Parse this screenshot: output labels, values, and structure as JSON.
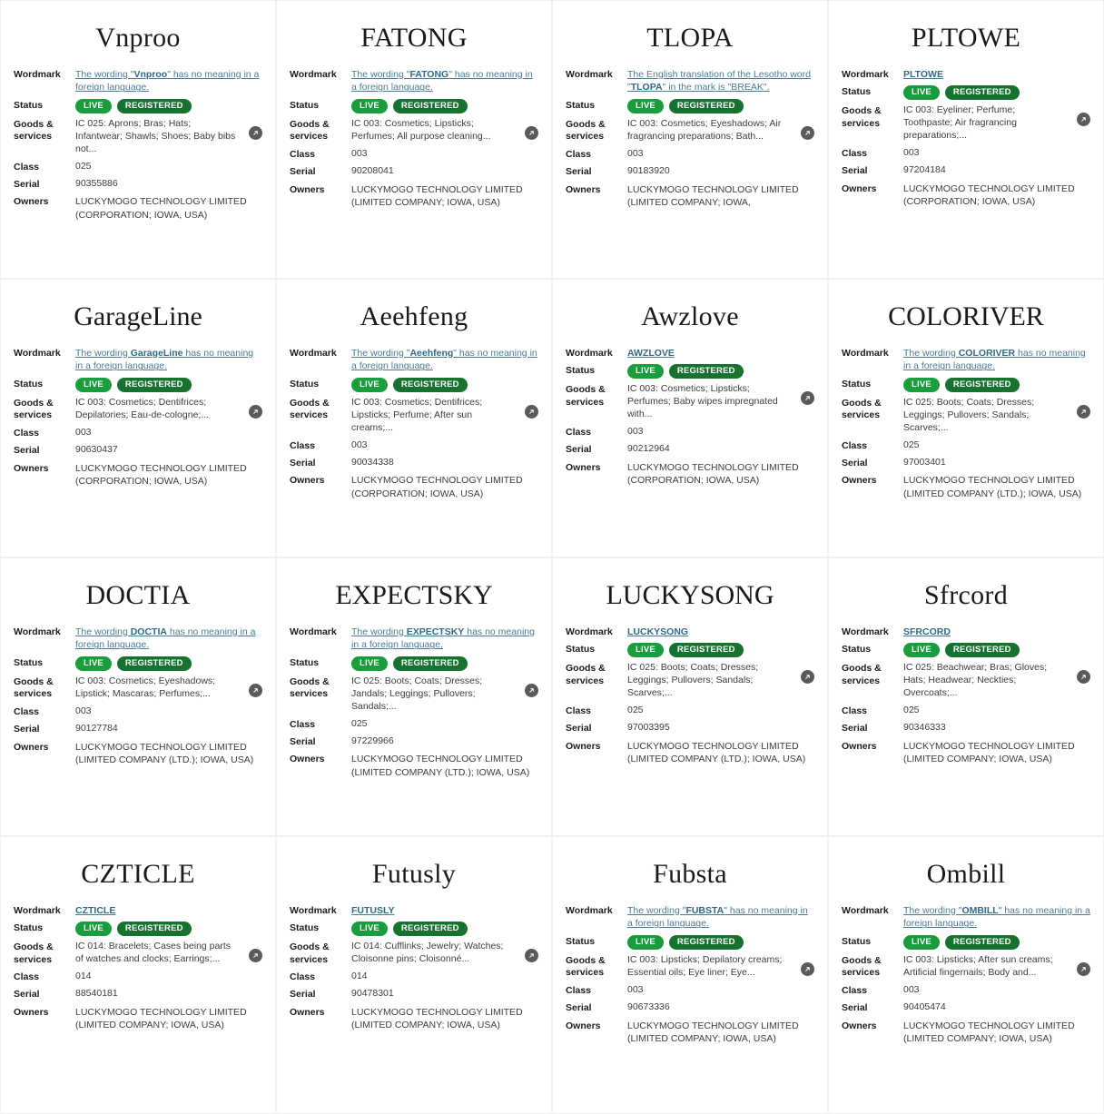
{
  "labels": {
    "wordmark": "Wordmark",
    "status": "Status",
    "goods_services": "Goods & services",
    "goods_services_line1": "Goods &",
    "goods_services_line2": "services",
    "class": "Class",
    "serial": "Serial",
    "owners": "Owners"
  },
  "badge_colors": {
    "live": "#1a9e3d",
    "registered": "#15732f",
    "link": "#4a7b95"
  },
  "icons": {
    "expand": "expand-arrow-icon"
  },
  "cards": [
    {
      "title": "Vnproo",
      "wordmark_prefix": "The wording \"",
      "wordmark_mark": "Vnproo",
      "wordmark_suffix": "\" has no meaning in a foreign language.",
      "status_live": "LIVE",
      "status_registered": "REGISTERED",
      "goods": "IC 025: Aprons; Bras; Hats; Infantwear; Shawls; Shoes; Baby bibs not...",
      "class": "025",
      "serial": "90355886",
      "owners": "LUCKYMOGO TECHNOLOGY LIMITED (CORPORATION; IOWA, USA)"
    },
    {
      "title": "FATONG",
      "wordmark_prefix": "The wording \"",
      "wordmark_mark": "FATONG",
      "wordmark_suffix": "\" has no meaning in a foreign language.",
      "status_live": "LIVE",
      "status_registered": "REGISTERED",
      "goods": "IC 003: Cosmetics; Lipsticks; Perfumes; All purpose cleaning...",
      "class": "003",
      "serial": "90208041",
      "owners": "LUCKYMOGO TECHNOLOGY LIMITED (LIMITED COMPANY; IOWA, USA)"
    },
    {
      "title": "TLOPA",
      "wordmark_prefix": "The English translation of the Lesotho word \"",
      "wordmark_mark": "TLOPA",
      "wordmark_suffix": "\" in the mark is \"BREAK\".",
      "status_live": "LIVE",
      "status_registered": "REGISTERED",
      "goods": "IC 003: Cosmetics; Eyeshadows; Air fragrancing preparations; Bath...",
      "class": "003",
      "serial": "90183920",
      "owners": "LUCKYMOGO TECHNOLOGY LIMITED (LIMITED COMPANY; IOWA,"
    },
    {
      "title": "PLTOWE",
      "wordmark_prefix": "",
      "wordmark_mark": "PLTOWE",
      "wordmark_suffix": "",
      "status_live": "LIVE",
      "status_registered": "REGISTERED",
      "goods": "IC 003: Eyeliner; Perfume; Toothpaste; Air fragrancing preparations;...",
      "class": "003",
      "serial": "97204184",
      "owners": "LUCKYMOGO TECHNOLOGY LIMITED (CORPORATION; IOWA, USA)"
    },
    {
      "title": "GarageLine",
      "wordmark_prefix": "The wording ",
      "wordmark_mark": "GarageLine",
      "wordmark_suffix": " has no meaning in a foreign language.",
      "status_live": "LIVE",
      "status_registered": "REGISTERED",
      "goods": "IC 003: Cosmetics; Dentifrices; Depilatories; Eau-de-cologne;...",
      "class": "003",
      "serial": "90630437",
      "owners": "LUCKYMOGO TECHNOLOGY LIMITED (CORPORATION; IOWA, USA)"
    },
    {
      "title": "Aeehfeng",
      "wordmark_prefix": "The wording \"",
      "wordmark_mark": "Aeehfeng",
      "wordmark_suffix": "\" has no meaning in a foreign language.",
      "status_live": "LIVE",
      "status_registered": "REGISTERED",
      "goods": "IC 003: Cosmetics; Dentifrices; Lipsticks; Perfume; After sun creams;...",
      "class": "003",
      "serial": "90034338",
      "owners": "LUCKYMOGO TECHNOLOGY LIMITED (CORPORATION; IOWA, USA)"
    },
    {
      "title": "Awzlove",
      "wordmark_prefix": "",
      "wordmark_mark": "AWZLOVE",
      "wordmark_suffix": "",
      "status_live": "LIVE",
      "status_registered": "REGISTERED",
      "goods": "IC 003: Cosmetics; Lipsticks; Perfumes; Baby wipes impregnated with...",
      "class": "003",
      "serial": "90212964",
      "owners": "LUCKYMOGO TECHNOLOGY LIMITED (CORPORATION; IOWA, USA)"
    },
    {
      "title": "COLORIVER",
      "wordmark_prefix": "The wording ",
      "wordmark_mark": "COLORIVER",
      "wordmark_suffix": " has no meaning in a foreign language.",
      "status_live": "LIVE",
      "status_registered": "REGISTERED",
      "goods": "IC 025: Boots; Coats; Dresses; Leggings; Pullovers; Sandals; Scarves;...",
      "class": "025",
      "serial": "97003401",
      "owners": "LUCKYMOGO TECHNOLOGY LIMITED (LIMITED COMPANY (LTD.); IOWA, USA)"
    },
    {
      "title": "DOCTIA",
      "wordmark_prefix": "The wording ",
      "wordmark_mark": "DOCTIA",
      "wordmark_suffix": " has no meaning in a foreign language.",
      "status_live": "LIVE",
      "status_registered": "REGISTERED",
      "goods": "IC 003: Cosmetics; Eyeshadows; Lipstick; Mascaras; Perfumes;...",
      "class": "003",
      "serial": "90127784",
      "owners": "LUCKYMOGO TECHNOLOGY LIMITED (LIMITED COMPANY (LTD.); IOWA, USA)"
    },
    {
      "title": "EXPECTSKY",
      "wordmark_prefix": "The wording ",
      "wordmark_mark": "EXPECTSKY",
      "wordmark_suffix": " has no meaning in a foreign language.",
      "status_live": "LIVE",
      "status_registered": "REGISTERED",
      "goods": "IC 025: Boots; Coats; Dresses; Jandals; Leggings; Pullovers; Sandals;...",
      "class": "025",
      "serial": "97229966",
      "owners": "LUCKYMOGO TECHNOLOGY LIMITED (LIMITED COMPANY (LTD.); IOWA, USA)"
    },
    {
      "title": "LUCKYSONG",
      "wordmark_prefix": "",
      "wordmark_mark": "LUCKYSONG",
      "wordmark_suffix": "",
      "status_live": "LIVE",
      "status_registered": "REGISTERED",
      "goods": "IC 025: Boots; Coats; Dresses; Leggings; Pullovers; Sandals; Scarves;...",
      "class": "025",
      "serial": "97003395",
      "owners": "LUCKYMOGO TECHNOLOGY LIMITED (LIMITED COMPANY (LTD.); IOWA, USA)"
    },
    {
      "title": "Sfrcord",
      "wordmark_prefix": "",
      "wordmark_mark": "SFRCORD",
      "wordmark_suffix": "",
      "status_live": "LIVE",
      "status_registered": "REGISTERED",
      "goods": "IC 025: Beachwear; Bras; Gloves; Hats; Headwear; Neckties; Overcoats;...",
      "class": "025",
      "serial": "90346333",
      "owners": "LUCKYMOGO TECHNOLOGY LIMITED (LIMITED COMPANY; IOWA, USA)"
    },
    {
      "title": "CZTICLE",
      "wordmark_prefix": "",
      "wordmark_mark": "CZTICLE",
      "wordmark_suffix": "",
      "status_live": "LIVE",
      "status_registered": "REGISTERED",
      "goods": "IC 014: Bracelets; Cases being parts of watches and clocks; Earrings;...",
      "class": "014",
      "serial": "88540181",
      "owners": "LUCKYMOGO TECHNOLOGY LIMITED (LIMITED COMPANY; IOWA, USA)"
    },
    {
      "title": "Futusly",
      "wordmark_prefix": "",
      "wordmark_mark": "FUTUSLY",
      "wordmark_suffix": "",
      "status_live": "LIVE",
      "status_registered": "REGISTERED",
      "goods": "IC 014: Cufflinks; Jewelry; Watches; Cloisonne pins; Cloisonné...",
      "class": "014",
      "serial": "90478301",
      "owners": "LUCKYMOGO TECHNOLOGY LIMITED (LIMITED COMPANY; IOWA, USA)"
    },
    {
      "title": "Fubsta",
      "wordmark_prefix": "The wording \"",
      "wordmark_mark": "FUBSTA",
      "wordmark_suffix": "\" has no meaning in a foreign language.",
      "status_live": "LIVE",
      "status_registered": "REGISTERED",
      "goods": "IC 003: Lipsticks; Depilatory creams; Essential oils; Eye liner; Eye...",
      "class": "003",
      "serial": "90673336",
      "owners": "LUCKYMOGO TECHNOLOGY LIMITED (LIMITED COMPANY; IOWA, USA)"
    },
    {
      "title": "Ombill",
      "wordmark_prefix": "The wording \"",
      "wordmark_mark": "OMBILL",
      "wordmark_suffix": "\" has no meaning in a foreign language.",
      "status_live": "LIVE",
      "status_registered": "REGISTERED",
      "goods": "IC 003: Lipsticks; After sun creams; Artificial fingernails; Body and...",
      "class": "003",
      "serial": "90405474",
      "owners": "LUCKYMOGO TECHNOLOGY LIMITED (LIMITED COMPANY; IOWA, USA)"
    }
  ]
}
